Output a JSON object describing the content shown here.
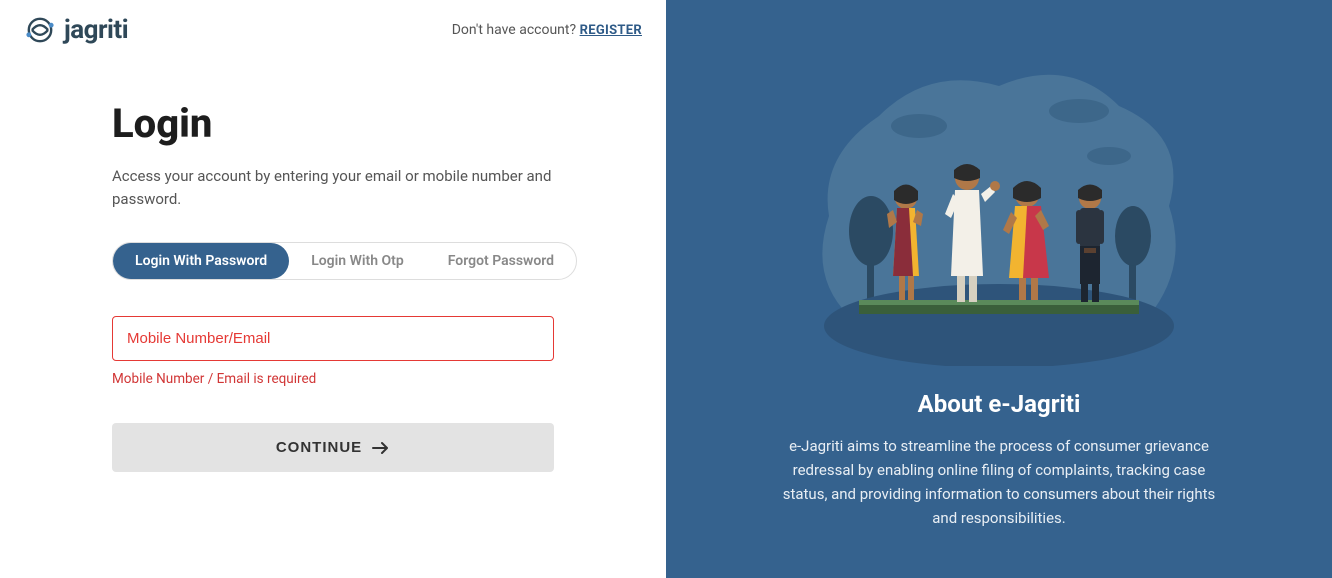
{
  "header": {
    "brand": "jagriti",
    "no_account_text": "Don't have account? ",
    "register_label": "REGISTER"
  },
  "login": {
    "title": "Login",
    "subtitle": "Access your account by entering your email or mobile number and password.",
    "tabs": {
      "password": "Login With Password",
      "otp": "Login With Otp",
      "forgot": "Forgot Password"
    },
    "input_placeholder": "Mobile Number/Email",
    "error_message": "Mobile Number / Email is required",
    "continue_label": "CONTINUE"
  },
  "about": {
    "title": "About e-Jagriti",
    "description": "e-Jagriti aims to streamline the process of consumer grievance redressal by enabling online filing of complaints, tracking case status, and providing information to consumers about their rights and responsibilities."
  }
}
